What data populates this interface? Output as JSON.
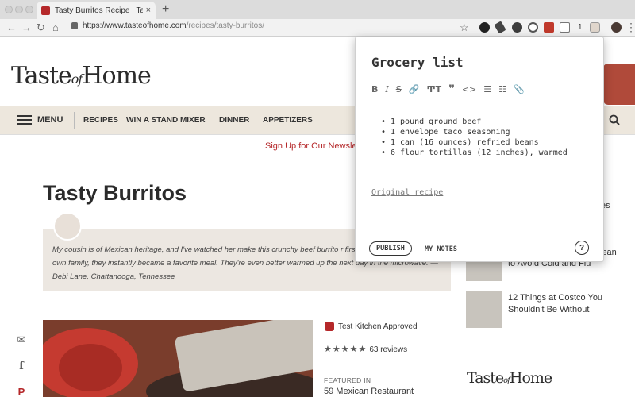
{
  "browser": {
    "tab_title": "Tasty Burritos Recipe | Taste of Home",
    "tab_close": "×",
    "new_tab": "+",
    "back": "←",
    "forward": "→",
    "reload": "↻",
    "home": "⌂",
    "url_host": "https://www.tasteofhome.com",
    "url_path": "/recipes/tasty-burritos/",
    "star": "☆",
    "menu": "⋮",
    "ext_badge": "1"
  },
  "site": {
    "logo_main_1": "Taste",
    "logo_of": "of",
    "logo_main_2": "Home",
    "nav": {
      "menu_label": "MENU",
      "items": [
        "RECIPES",
        "WIN A STAND MIXER",
        "DINNER",
        "APPETIZERS"
      ]
    },
    "promo": "Sign Up for Our Newsle"
  },
  "recipe": {
    "title": "Tasty Burritos",
    "quote": "My cousin is of Mexican heritage, and I've watched her make this crunchy beef burrito r first time I made them for my own family, they instantly became a favorite meal. They're even better warmed up the next day in the microwave. —Debi Lane, Chattanooga, Tennessee",
    "approved": "Test Kitchen Approved",
    "stars": "★★★★★",
    "reviews": "63 reviews",
    "featured_label": "FEATURED IN",
    "featured_value": "59 Mexican Restaurant"
  },
  "sidebar": {
    "item1_frag": "es",
    "item2_frag_a": "lean",
    "item2_frag_b": "to Avoid Cold and Flu",
    "item3": "12 Things at Costco You Shouldn't Be Without"
  },
  "popup": {
    "title": "Grocery list",
    "toolbar": [
      "B",
      "I",
      "S",
      "🔗",
      "ͲT",
      "❞",
      "<>",
      "☰",
      "☷",
      "📎"
    ],
    "items": [
      "1 pound ground beef",
      "1 envelope taco seasoning",
      "1 can (16 ounces) refried beans",
      "6 flour tortillas (12 inches), warmed"
    ],
    "link": "Original recipe",
    "publish": "PUBLISH",
    "my_notes": "MY NOTES",
    "help": "?"
  },
  "colors": {
    "brand_red": "#b5282a",
    "nav_bg": "#ede7dd",
    "quote_bg": "#ece7e1"
  }
}
